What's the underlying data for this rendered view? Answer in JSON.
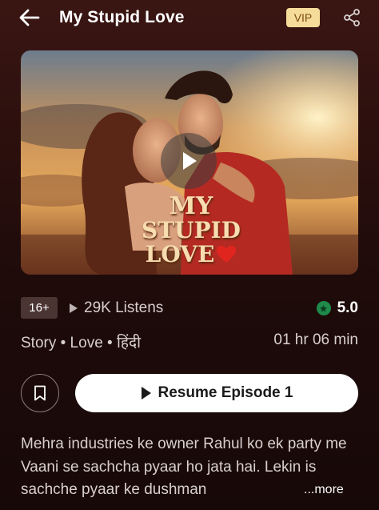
{
  "header": {
    "title": "My Stupid Love",
    "vip_label": "VIP"
  },
  "cover": {
    "title_line1": "MY",
    "title_line2": "STUPID",
    "title_line3": "LOVE"
  },
  "meta": {
    "age_rating": "16+",
    "listens": "29K Listens",
    "rating": "5.0"
  },
  "info": {
    "genre": "Story • Love • हिंदी",
    "duration": "01 hr 06 min"
  },
  "actions": {
    "resume_label": "Resume Episode 1"
  },
  "description": {
    "text": "Mehra industries ke owner Rahul ko ek party me Vaani se sachcha pyaar ho jata hai. Lekin is sachche pyaar ke dushman",
    "more_label": "...more"
  },
  "colors": {
    "vip_bg": "#f6dc9a",
    "rating_star": "#1f8a4a",
    "background": "#1c0b0a"
  }
}
